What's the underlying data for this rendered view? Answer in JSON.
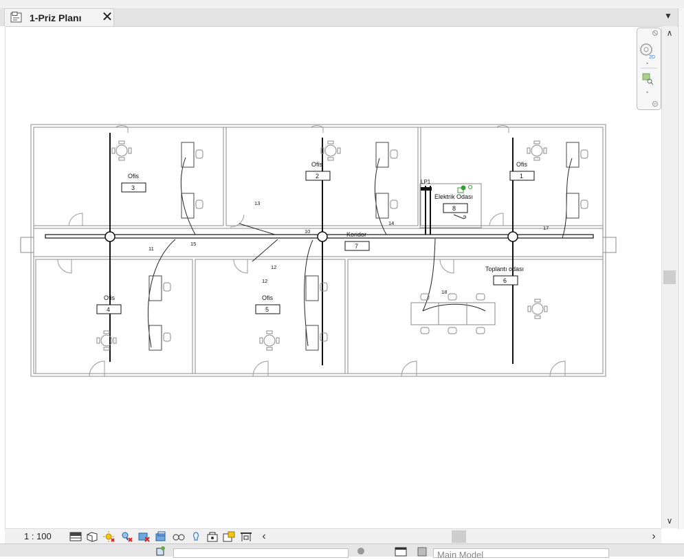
{
  "tab": {
    "title": "1-Priz Planı"
  },
  "status": {
    "scale": "1 : 100",
    "model": "Main Model"
  },
  "plan": {
    "rooms": [
      {
        "name": "Ofis",
        "number": "3"
      },
      {
        "name": "Ofis",
        "number": "2"
      },
      {
        "name": "Ofis",
        "number": "1"
      },
      {
        "name": "Elektrik Odası",
        "number": "8"
      },
      {
        "name": "Koridor",
        "number": "7"
      },
      {
        "name": "Toplantı odası",
        "number": "6"
      },
      {
        "name": "Ofis",
        "number": "4"
      },
      {
        "name": "Ofis",
        "number": "5"
      }
    ],
    "panel": "LP1",
    "circuit_tags": [
      "9",
      "10",
      "11",
      "12",
      "12",
      "13",
      "14",
      "15",
      "17",
      "18"
    ]
  },
  "icons": {
    "tab": "drawing-view-icon",
    "nav": [
      "steering-wheel-2d-icon",
      "zoom-region-icon"
    ],
    "view_control": [
      "detail-level-icon",
      "visual-style-icon",
      "sun-path-icon",
      "shadows-icon",
      "crop-view-icon",
      "show-crop-icon",
      "temporary-hide-icon",
      "reveal-hidden-icon",
      "lock-3d-icon",
      "temporary-view-properties-icon",
      "worksharing-display-icon",
      "analytical-model-icon"
    ]
  },
  "colors": {
    "selected_green": "#2fa12f",
    "tab_bg": "#f3f3f3",
    "chrome": "#e3e3e3"
  }
}
